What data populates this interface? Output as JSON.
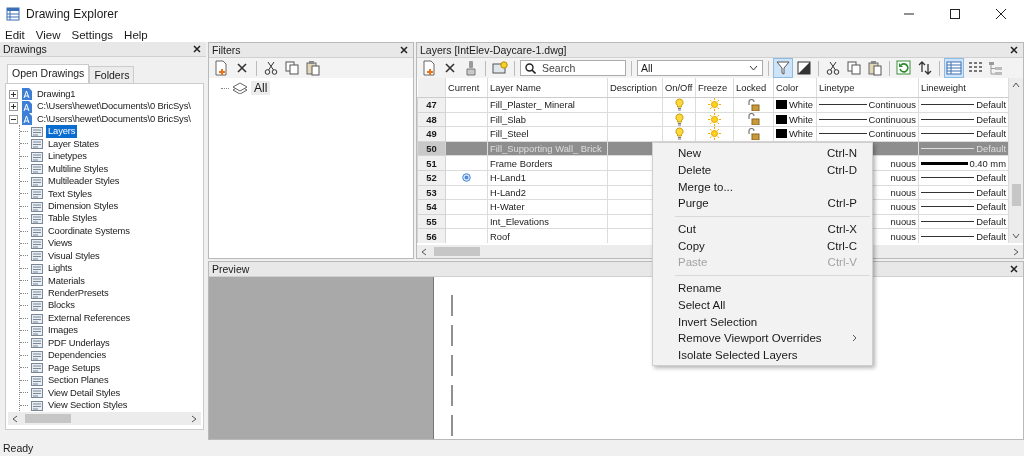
{
  "window": {
    "title": "Drawing Explorer"
  },
  "menu": [
    "Edit",
    "View",
    "Settings",
    "Help"
  ],
  "drawings": {
    "title": "Drawings",
    "tabs": [
      {
        "label": "Open Drawings",
        "selected": true
      },
      {
        "label": "Folders",
        "selected": false
      }
    ],
    "tree": [
      {
        "label": "Drawing1",
        "expanded": false,
        "selected": false
      },
      {
        "label": "C:\\Users\\hewet\\Documents\\0 BricSys\\",
        "expanded": false,
        "selected": false
      },
      {
        "label": "C:\\Users\\hewet\\Documents\\0 BricSys\\",
        "expanded": true,
        "selected": false,
        "children": [
          {
            "label": "Layers",
            "selected": true
          },
          {
            "label": "Layer States",
            "selected": false
          },
          {
            "label": "Linetypes",
            "selected": false
          },
          {
            "label": "Multiline Styles",
            "selected": false
          },
          {
            "label": "Multileader Styles",
            "selected": false
          },
          {
            "label": "Text Styles",
            "selected": false
          },
          {
            "label": "Dimension Styles",
            "selected": false
          },
          {
            "label": "Table Styles",
            "selected": false
          },
          {
            "label": "Coordinate Systems",
            "selected": false
          },
          {
            "label": "Views",
            "selected": false
          },
          {
            "label": "Visual Styles",
            "selected": false
          },
          {
            "label": "Lights",
            "selected": false
          },
          {
            "label": "Materials",
            "selected": false
          },
          {
            "label": "RenderPresets",
            "selected": false
          },
          {
            "label": "Blocks",
            "selected": false
          },
          {
            "label": "External References",
            "selected": false
          },
          {
            "label": "Images",
            "selected": false
          },
          {
            "label": "PDF Underlays",
            "selected": false
          },
          {
            "label": "Dependencies",
            "selected": false
          },
          {
            "label": "Page Setups",
            "selected": false
          },
          {
            "label": "Section Planes",
            "selected": false
          },
          {
            "label": "View Detail Styles",
            "selected": false
          },
          {
            "label": "View Section Styles",
            "selected": false
          }
        ]
      }
    ]
  },
  "filters": {
    "title": "Filters",
    "items": [
      {
        "label": "All",
        "selected": true
      }
    ]
  },
  "layers": {
    "title": "Layers [IntElev-Daycare-1.dwg]",
    "toolbar": [
      {
        "kind": "button",
        "selected": false
      },
      {
        "kind": "button",
        "selected": false
      },
      {
        "kind": "button",
        "selected": false
      },
      {
        "kind": "separator"
      },
      {
        "kind": "button",
        "selected": false
      },
      {
        "kind": "separator"
      },
      {
        "kind": "search",
        "placeholder": "Search"
      },
      {
        "kind": "separator"
      },
      {
        "kind": "dropdown",
        "value": "All"
      },
      {
        "kind": "separator"
      },
      {
        "kind": "button",
        "selected": true
      },
      {
        "kind": "button",
        "selected": false
      },
      {
        "kind": "separator"
      },
      {
        "kind": "button",
        "selected": false
      },
      {
        "kind": "button",
        "selected": false
      },
      {
        "kind": "button",
        "selected": false
      },
      {
        "kind": "separator"
      },
      {
        "kind": "button",
        "selected": false
      },
      {
        "kind": "button",
        "selected": false
      },
      {
        "kind": "separator"
      },
      {
        "kind": "button",
        "selected": true
      },
      {
        "kind": "button",
        "selected": false
      },
      {
        "kind": "button",
        "selected": false
      }
    ],
    "columns": [
      "Current",
      "Layer Name",
      "Description",
      "On/Off",
      "Freeze",
      "Locked",
      "Color",
      "Linetype",
      "Lineweight"
    ],
    "rows": [
      {
        "kind": "full",
        "number": "47",
        "selected": false,
        "current": false,
        "name": "Fill_Plaster_ Mineral",
        "on": true,
        "frozen": false,
        "locked": false,
        "color": "#000000",
        "color_name": "White",
        "linetype": "Continuous",
        "lineweight": "Default",
        "heavy": false
      },
      {
        "kind": "full",
        "number": "48",
        "selected": false,
        "current": false,
        "name": "Fill_Slab",
        "on": true,
        "frozen": false,
        "locked": false,
        "color": "#000000",
        "color_name": "White",
        "linetype": "Continuous",
        "lineweight": "Default",
        "heavy": false
      },
      {
        "kind": "full",
        "number": "49",
        "selected": false,
        "current": false,
        "name": "Fill_Steel",
        "on": true,
        "frozen": false,
        "locked": false,
        "color": "#000000",
        "color_name": "White",
        "linetype": "Continuous",
        "lineweight": "Default",
        "heavy": false
      },
      {
        "kind": "covered",
        "number": "50",
        "selected": true,
        "current": false,
        "name": "Fill_Supporting Wall_ Brick",
        "lineweight": "Default",
        "heavy": false
      },
      {
        "kind": "covered",
        "number": "51",
        "selected": false,
        "current": false,
        "name": "Frame Borders",
        "linetype": "nuous",
        "lineweight": "0.40 mm",
        "heavy": true
      },
      {
        "kind": "covered",
        "number": "52",
        "selected": false,
        "current": true,
        "name": "H-Land1",
        "linetype": "nuous",
        "lineweight": "Default",
        "heavy": false
      },
      {
        "kind": "covered",
        "number": "53",
        "selected": false,
        "current": false,
        "name": "H-Land2",
        "linetype": "nuous",
        "lineweight": "Default",
        "heavy": false
      },
      {
        "kind": "covered",
        "number": "54",
        "selected": false,
        "current": false,
        "name": "H-Water",
        "linetype": "nuous",
        "lineweight": "Default",
        "heavy": false
      },
      {
        "kind": "covered",
        "number": "55",
        "selected": false,
        "current": false,
        "name": "Int_Elevations",
        "linetype": "nuous",
        "lineweight": "Default",
        "heavy": false
      },
      {
        "kind": "covered",
        "number": "56",
        "selected": false,
        "current": false,
        "name": "Roof",
        "linetype": "nuous",
        "lineweight": "Default",
        "heavy": false
      }
    ]
  },
  "preview": {
    "title": "Preview"
  },
  "context_menu": {
    "items": [
      {
        "kind": "item",
        "label": "New",
        "shortcut": "Ctrl-N",
        "disabled": false
      },
      {
        "kind": "item",
        "label": "Delete",
        "shortcut": "Ctrl-D",
        "disabled": false
      },
      {
        "kind": "item",
        "label": "Merge to...",
        "disabled": false
      },
      {
        "kind": "item",
        "label": "Purge",
        "shortcut": "Ctrl-P",
        "disabled": false
      },
      {
        "kind": "separator"
      },
      {
        "kind": "item",
        "label": "Cut",
        "shortcut": "Ctrl-X",
        "disabled": false
      },
      {
        "kind": "item",
        "label": "Copy",
        "shortcut": "Ctrl-C",
        "disabled": false
      },
      {
        "kind": "item",
        "label": "Paste",
        "shortcut": "Ctrl-V",
        "disabled": true
      },
      {
        "kind": "separator"
      },
      {
        "kind": "item",
        "label": "Rename",
        "disabled": false
      },
      {
        "kind": "item",
        "label": "Select All",
        "disabled": false
      },
      {
        "kind": "item",
        "label": "Invert Selection",
        "disabled": false
      },
      {
        "kind": "item",
        "label": "Remove Viewport Overrides",
        "disabled": false,
        "submenu": true
      },
      {
        "kind": "item",
        "label": "Isolate Selected Layers",
        "disabled": false
      }
    ]
  },
  "status_bar": {
    "text": "Ready"
  }
}
